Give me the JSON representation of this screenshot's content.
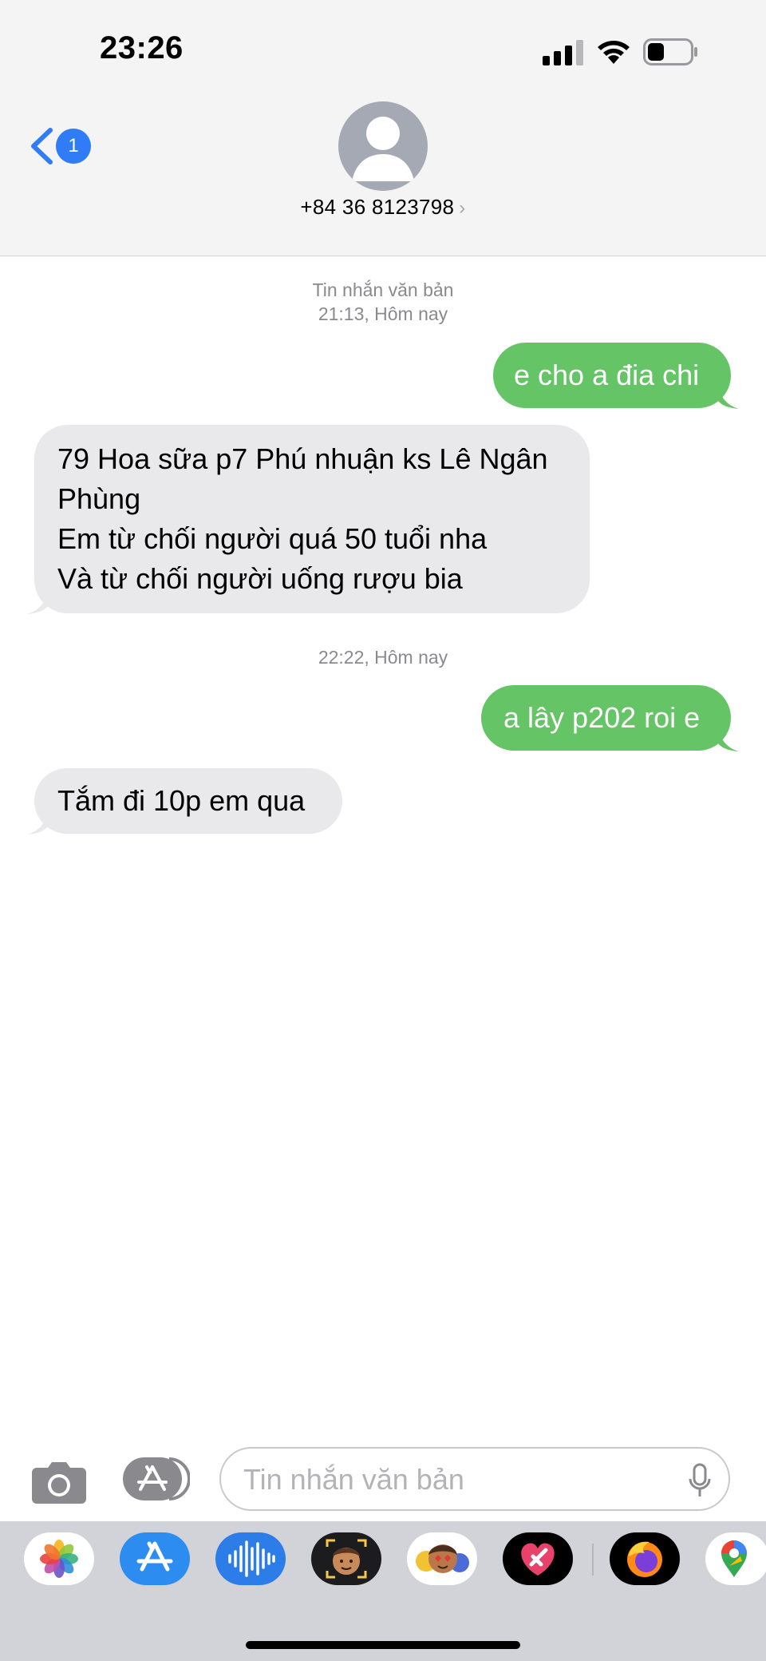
{
  "status": {
    "time": "23:26"
  },
  "header": {
    "back_count": "1",
    "contact": "+84 36 8123798",
    "chevron": "›"
  },
  "conversation": [
    {
      "type": "stamp",
      "lines": [
        "Tin nhắn văn bản",
        "21:13, Hôm nay"
      ]
    },
    {
      "type": "outgoing",
      "text": "e cho a đia chi"
    },
    {
      "type": "incoming",
      "lines": [
        "79 Hoa sữa p7 Phú nhuận ks Lê Ngân",
        "Phùng",
        "Em từ chối người quá 50 tuổi nha",
        "Và từ chối người uống rượu bia"
      ]
    },
    {
      "type": "stamp",
      "lines": [
        "22:22, Hôm nay"
      ]
    },
    {
      "type": "outgoing",
      "text": "a lây p202 roi e"
    },
    {
      "type": "incoming",
      "lines": [
        "Tắm đi 10p em qua"
      ]
    }
  ],
  "composer": {
    "placeholder": "Tin nhắn văn bản"
  },
  "drawer": {
    "apps": [
      "photos-app-icon",
      "app-store-app-icon",
      "audio-message-app-icon",
      "memoji-app-icon",
      "animoji-stickers-app-icon",
      "digital-touch-app-icon",
      "firefox-app-icon",
      "google-maps-app-icon"
    ]
  },
  "colors": {
    "outgoing": "#65c466",
    "incoming": "#e9e9eb",
    "accent": "#2f7cf6"
  }
}
